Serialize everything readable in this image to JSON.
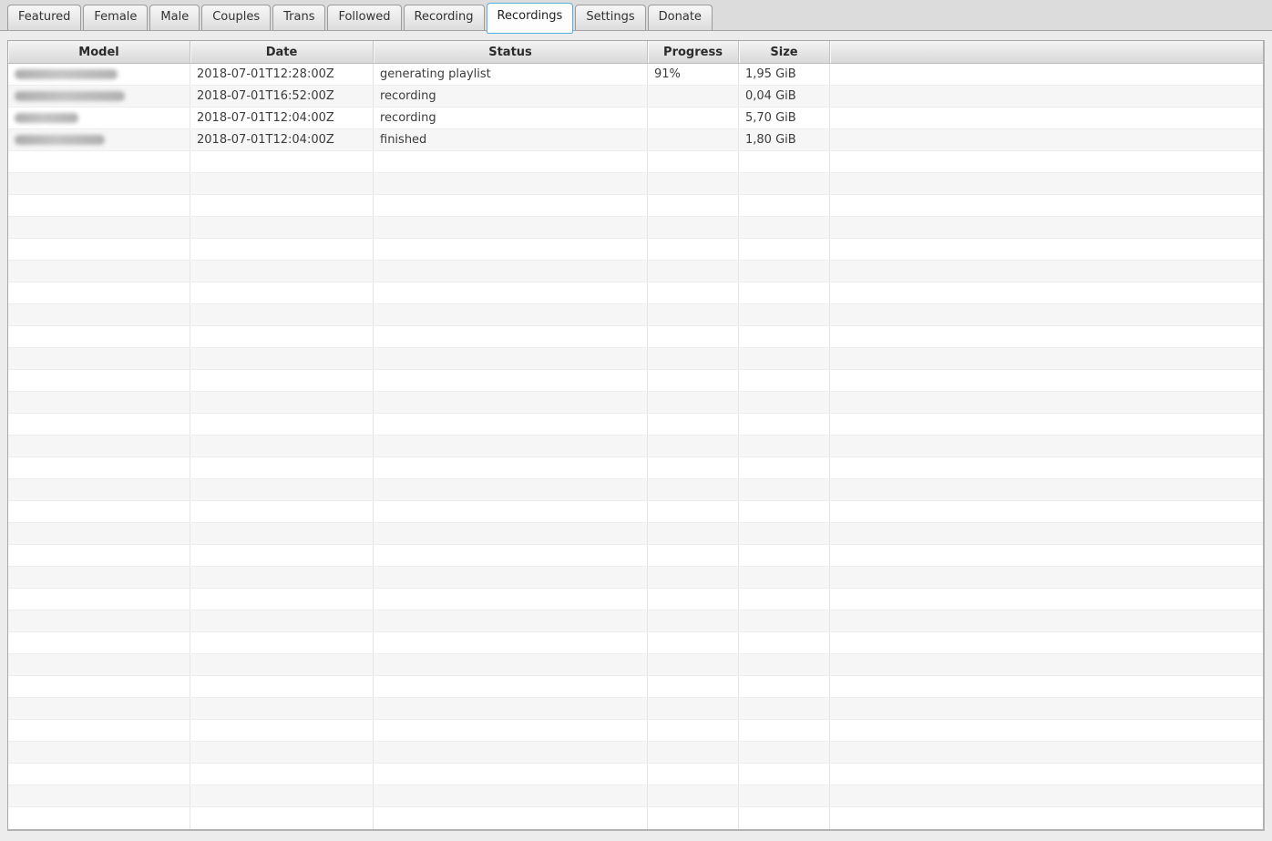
{
  "app": {
    "accent_color": "#58b1dc",
    "active_tab": "Recordings"
  },
  "tabs": [
    {
      "label": "Featured",
      "active": false
    },
    {
      "label": "Female",
      "active": false
    },
    {
      "label": "Male",
      "active": false
    },
    {
      "label": "Couples",
      "active": false
    },
    {
      "label": "Trans",
      "active": false
    },
    {
      "label": "Followed",
      "active": false
    },
    {
      "label": "Recording",
      "active": false
    },
    {
      "label": "Recordings",
      "active": true
    },
    {
      "label": "Settings",
      "active": false
    },
    {
      "label": "Donate",
      "active": false
    }
  ],
  "table": {
    "headers": [
      "Model",
      "Date",
      "Status",
      "Progress",
      "Size",
      ""
    ],
    "rows": [
      {
        "model": "",
        "model_redacted": true,
        "model_blur_width": 113,
        "date": "2018-07-01T12:28:00Z",
        "status": "generating playlist",
        "progress": "91%",
        "size": "1,95 GiB"
      },
      {
        "model": "",
        "model_redacted": true,
        "model_blur_width": 121,
        "date": "2018-07-01T16:52:00Z",
        "status": "recording",
        "progress": "",
        "size": "0,04 GiB"
      },
      {
        "model": "",
        "model_redacted": true,
        "model_blur_width": 70,
        "date": "2018-07-01T12:04:00Z",
        "status": "recording",
        "progress": "",
        "size": "5,70 GiB"
      },
      {
        "model": "",
        "model_redacted": true,
        "model_blur_width": 99,
        "date": "2018-07-01T12:04:00Z",
        "status": "finished",
        "progress": "",
        "size": "1,80 GiB"
      }
    ],
    "empty_row_count": 31
  }
}
